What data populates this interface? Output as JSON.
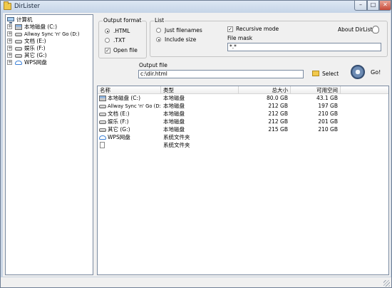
{
  "window": {
    "title": "DirLister",
    "minimize_glyph": "–",
    "maximize_glyph": "□",
    "close_glyph": "✕"
  },
  "tree": {
    "root": {
      "label": "计算机",
      "icon": "computer-icon"
    },
    "items": [
      {
        "label": "本地磁盘 (C:)",
        "icon": "system-drive-icon",
        "expander": "+"
      },
      {
        "label": "Allway Sync 'n' Go (D:)",
        "icon": "drive-icon",
        "expander": "+"
      },
      {
        "label": "文档 (E:)",
        "icon": "drive-icon",
        "expander": "+"
      },
      {
        "label": "娱乐 (F:)",
        "icon": "drive-icon",
        "expander": "+"
      },
      {
        "label": "其它 (G:)",
        "icon": "drive-icon",
        "expander": "+"
      },
      {
        "label": "WPS网盘",
        "icon": "cloud-icon",
        "expander": "+"
      }
    ]
  },
  "output_format": {
    "title": "Output format",
    "options": [
      {
        "label": ".HTML",
        "selected": true
      },
      {
        "label": ".TXT",
        "selected": false
      }
    ],
    "open_file": {
      "label": "Open file",
      "checked": true,
      "mark": "✓"
    }
  },
  "list_options": {
    "title": "List",
    "options": [
      {
        "label": "Just filenames",
        "selected": false
      },
      {
        "label": "Include size",
        "selected": true
      }
    ],
    "recursive": {
      "label": "Recursive mode",
      "checked": true,
      "mark": "✓"
    },
    "file_mask_label": "File mask",
    "file_mask_value": "*.*"
  },
  "about": {
    "label": "About DirLister",
    "icon": "mouse-icon"
  },
  "output_file": {
    "label": "Output file",
    "value": "c:\\dir.html"
  },
  "select_button": {
    "label": "Select",
    "icon": "folder-icon"
  },
  "go_button": {
    "label": "Go!",
    "icon": "gear-icon"
  },
  "list": {
    "columns": {
      "name": "名称",
      "type": "类型",
      "total": "总大小",
      "free": "可用空间"
    },
    "rows": [
      {
        "name": "本地磁盘 (C:)",
        "icon": "system-drive-icon",
        "type": "本地磁盘",
        "total": "80.0 GB",
        "free": "43.1 GB"
      },
      {
        "name": "Allway Sync 'n' Go (D:)",
        "icon": "drive-icon",
        "type": "本地磁盘",
        "total": "212 GB",
        "free": "197 GB"
      },
      {
        "name": "文档 (E:)",
        "icon": "drive-icon",
        "type": "本地磁盘",
        "total": "212 GB",
        "free": "210 GB"
      },
      {
        "name": "娱乐 (F:)",
        "icon": "drive-icon",
        "type": "本地磁盘",
        "total": "212 GB",
        "free": "201 GB"
      },
      {
        "name": "其它 (G:)",
        "icon": "drive-icon",
        "type": "本地磁盘",
        "total": "215 GB",
        "free": "210 GB"
      },
      {
        "name": "WPS网盘",
        "icon": "cloud-icon",
        "type": "系统文件夹",
        "total": "",
        "free": ""
      },
      {
        "name": "",
        "icon": "file-icon",
        "type": "系统文件夹",
        "total": "",
        "free": ""
      }
    ]
  },
  "colors": {
    "window_frame": "#c9d6e6",
    "client_bg": "#f0f0f0",
    "close_button": "#c74a38"
  }
}
